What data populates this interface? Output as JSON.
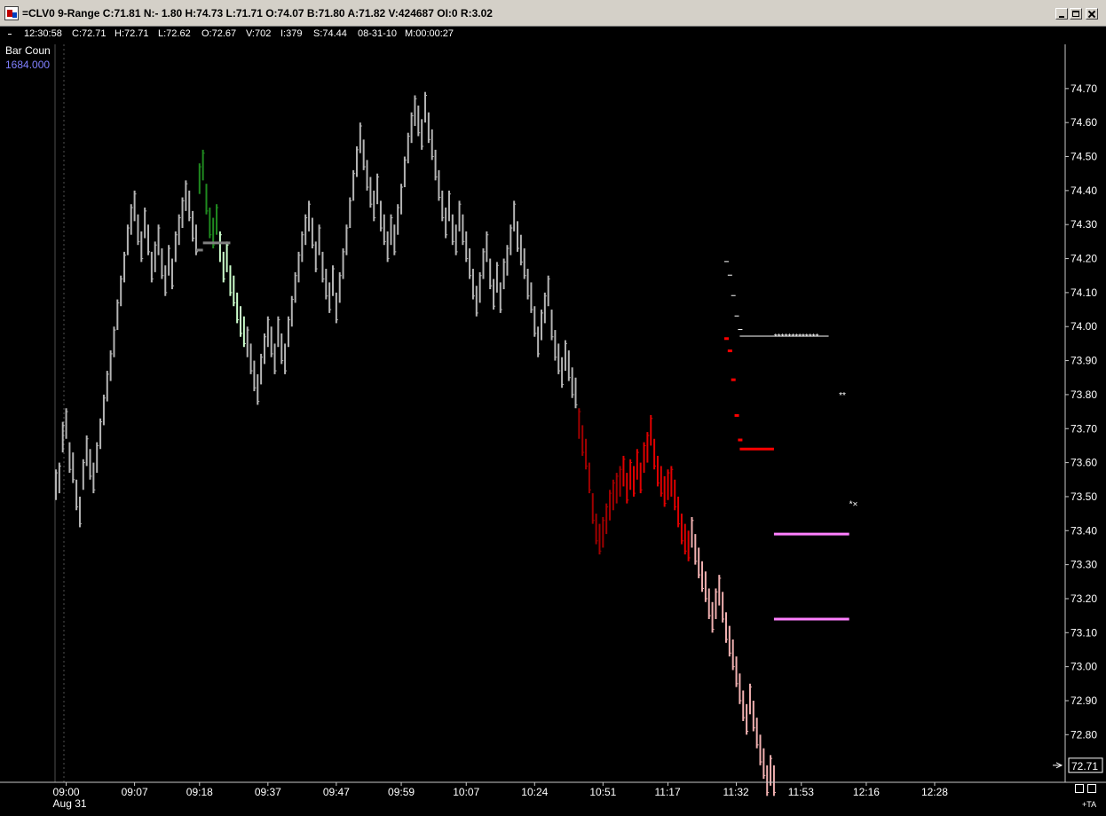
{
  "window": {
    "title": "=CLV0 9-Range C:71.81 N:- 1.80 H:74.73 L:71.71 O:74.07 B:71.80 A:71.82 V:424687 OI:0 R:3.02"
  },
  "data_window": {
    "time": "12:30:58",
    "close": "C:72.71",
    "high": "H:72.71",
    "low": "L:72.62",
    "open": "O:72.67",
    "volume": "V:702",
    "ticks": "I:379",
    "s": "S:74.44",
    "date": "08-31-10",
    "m": "M:00:00:27"
  },
  "indicator": {
    "name": "Bar Coun",
    "value": "1684.000"
  },
  "colors": {
    "background": "#000000",
    "bar_gray": "#b4b4b4",
    "bar_darkgreen": "#1f8a1f",
    "bar_lightgreen": "#ccffcc",
    "bar_red": "#e00000",
    "bar_darkred": "#a00000",
    "bar_pink": "#f0b0b0",
    "magenta_level": "#ff80ff",
    "axis_line": "#c8c8c8",
    "text": "#ffffff",
    "indicator_value": "#8080ff"
  },
  "corner": {
    "label": "+TA"
  },
  "chart_data": {
    "type": "range-bar",
    "title": "",
    "ylim": [
      72.66,
      74.83
    ],
    "y_ticks": [
      "74.70",
      "74.60",
      "74.50",
      "74.40",
      "74.30",
      "74.20",
      "74.10",
      "74.00",
      "73.90",
      "73.80",
      "73.70",
      "73.60",
      "73.50",
      "73.40",
      "73.30",
      "73.20",
      "73.10",
      "73.00",
      "72.90",
      "72.80"
    ],
    "x_ticks": [
      {
        "label": "09:00",
        "bar": 3
      },
      {
        "label": "09:07",
        "bar": 23
      },
      {
        "label": "09:18",
        "bar": 42
      },
      {
        "label": "09:37",
        "bar": 62
      },
      {
        "label": "09:47",
        "bar": 82
      },
      {
        "label": "09:59",
        "bar": 101
      },
      {
        "label": "10:07",
        "bar": 120
      },
      {
        "label": "10:24",
        "bar": 140
      },
      {
        "label": "10:51",
        "bar": 160
      },
      {
        "label": "11:17",
        "bar": 179
      },
      {
        "label": "11:32",
        "bar": 199
      },
      {
        "label": "11:53",
        "bar": 218
      },
      {
        "label": "12:16",
        "bar": 237
      },
      {
        "label": "12:28",
        "bar": 257
      }
    ],
    "date_label": "Aug 31",
    "last_price": "72.71",
    "bars_gray_1": [
      73.58,
      73.6,
      73.72,
      73.76,
      73.66,
      73.63,
      73.55,
      73.5,
      73.61,
      73.68,
      73.64,
      73.6,
      73.66,
      73.73,
      73.8,
      73.87,
      73.93,
      74.0,
      74.08,
      74.15,
      74.22,
      74.3,
      74.36,
      74.4,
      74.33,
      74.28,
      74.35,
      74.3,
      74.22,
      74.25,
      74.3,
      74.23,
      74.18,
      74.24,
      74.2,
      74.28,
      74.33,
      74.38,
      74.43,
      74.4,
      74.34,
      74.3
    ],
    "bars_darkgreen": [
      74.48,
      74.52,
      74.42,
      74.35,
      74.32,
      74.36
    ],
    "bars_lightgreen": [
      74.28,
      74.22,
      74.25,
      74.18,
      74.15,
      74.1,
      74.06,
      74.03
    ],
    "bars_gray_2": [
      74.0,
      73.95,
      73.9,
      73.86,
      73.92,
      73.98,
      74.03,
      74.0,
      73.95,
      74.03,
      73.98,
      73.95,
      74.03,
      74.09,
      74.16,
      74.22,
      74.28,
      74.33,
      74.37,
      74.32,
      74.25,
      74.3,
      74.22,
      74.17,
      74.13,
      74.18,
      74.1,
      74.16,
      74.23,
      74.3,
      74.38,
      74.46,
      74.53,
      74.6,
      74.55,
      74.49,
      74.44,
      74.4,
      74.45,
      74.37,
      74.33,
      74.28,
      74.33,
      74.3,
      74.36,
      74.42,
      74.5,
      74.57,
      74.63,
      74.68,
      74.65,
      74.61,
      74.69,
      74.63,
      74.58,
      74.52,
      74.46,
      74.4,
      74.35,
      74.4,
      74.33,
      74.3,
      74.37,
      74.33,
      74.28,
      74.23,
      74.17,
      74.12,
      74.16,
      74.23,
      74.28,
      74.2,
      74.14,
      74.19,
      74.13,
      74.2,
      74.24,
      74.3,
      74.37,
      74.31,
      74.27,
      74.23,
      74.17,
      74.13,
      74.06,
      74.0,
      74.05,
      74.1,
      74.15,
      74.05,
      73.99,
      73.95,
      73.91,
      73.96,
      73.93,
      73.88,
      73.85
    ],
    "bars_red_1": [
      73.76,
      73.71,
      73.67,
      73.6,
      73.51,
      73.45,
      73.42,
      73.44,
      73.48,
      73.52,
      73.55,
      73.57,
      73.59
    ],
    "bars_red_2": [
      73.62,
      73.57,
      73.61,
      73.59,
      73.64,
      73.6,
      73.66,
      73.69,
      73.74,
      73.67,
      73.62,
      73.59,
      73.56,
      73.58,
      73.59,
      73.55,
      73.5,
      73.45,
      73.42,
      73.4
    ],
    "bars_pink": [
      73.44,
      73.39,
      73.35,
      73.31,
      73.28,
      73.23,
      73.19,
      73.23,
      73.27,
      73.22,
      73.16,
      73.12,
      73.08,
      73.03,
      72.98,
      72.93,
      72.89,
      72.95,
      72.9,
      72.85,
      72.8,
      72.76,
      72.71,
      72.74,
      72.71
    ],
    "levels": [
      {
        "value": 73.972,
        "color": "#ffffff",
        "from_bar": 200,
        "to_bar": 226,
        "label": "*************"
      },
      {
        "value": 73.64,
        "color": "#ff0000",
        "from_bar": 200,
        "to_bar": 210
      },
      {
        "value": 73.39,
        "color": "#ff80ff",
        "from_bar": 210,
        "to_bar": 232
      },
      {
        "value": 73.14,
        "color": "#ff80ff",
        "from_bar": 210,
        "to_bar": 232
      },
      {
        "value": 74.246,
        "color": "#808080",
        "from_bar": 43,
        "to_bar": 51
      },
      {
        "value": 74.225,
        "color": "#808080",
        "from_bar": 41,
        "to_bar": 43
      }
    ],
    "markers": [
      {
        "bar": 196,
        "value": 74.19,
        "color": "#ffffff"
      },
      {
        "bar": 197,
        "value": 74.15,
        "color": "#ffffff"
      },
      {
        "bar": 198,
        "value": 74.09,
        "color": "#ffffff"
      },
      {
        "bar": 199,
        "value": 74.03,
        "color": "#ffffff"
      },
      {
        "bar": 200,
        "value": 73.99,
        "color": "#ffffff"
      },
      {
        "bar": 196,
        "value": 73.966,
        "color": "#ff0000"
      },
      {
        "bar": 197,
        "value": 73.93,
        "color": "#ff0000"
      },
      {
        "bar": 198,
        "value": 73.845,
        "color": "#ff0000"
      },
      {
        "bar": 199,
        "value": 73.74,
        "color": "#ff0000"
      },
      {
        "bar": 200,
        "value": 73.668,
        "color": "#ff0000"
      }
    ],
    "star_marks": [
      {
        "bar": 229,
        "value": 73.8,
        "label": "**"
      },
      {
        "bar": 232,
        "value": 73.48,
        "label": "*×"
      }
    ]
  }
}
